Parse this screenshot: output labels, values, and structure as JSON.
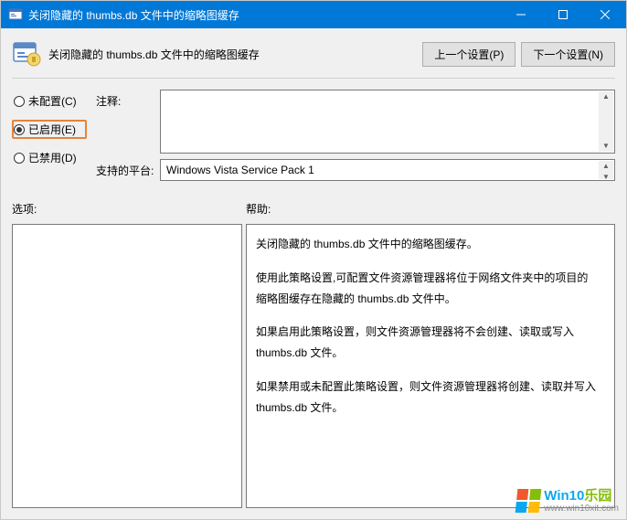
{
  "window": {
    "title": "关闭隐藏的 thumbs.db 文件中的缩略图缓存"
  },
  "header": {
    "policy_title": "关闭隐藏的 thumbs.db 文件中的缩略图缓存",
    "prev_btn": "上一个设置(P)",
    "next_btn": "下一个设置(N)"
  },
  "radios": {
    "not_configured": "未配置(C)",
    "enabled": "已启用(E)",
    "disabled": "已禁用(D)"
  },
  "labels": {
    "comment": "注释:",
    "platform": "支持的平台:",
    "options": "选项:",
    "help": "帮助:"
  },
  "fields": {
    "comment_value": "",
    "platform_value": "Windows Vista Service Pack 1"
  },
  "help_text": {
    "p1": "关闭隐藏的 thumbs.db 文件中的缩略图缓存。",
    "p2": "使用此策略设置,可配置文件资源管理器将位于网络文件夹中的项目的缩略图缓存在隐藏的 thumbs.db 文件中。",
    "p3": "如果启用此策略设置，则文件资源管理器将不会创建、读取或写入 thumbs.db 文件。",
    "p4": "如果禁用或未配置此策略设置，则文件资源管理器将创建、读取并写入 thumbs.db 文件。"
  },
  "watermark": {
    "brand_main": "Win10",
    "brand_suffix": "乐园",
    "url": "www.win10xit.com"
  }
}
